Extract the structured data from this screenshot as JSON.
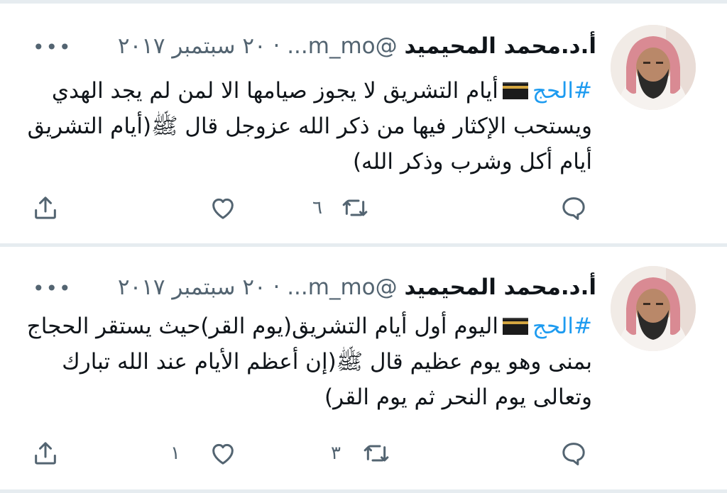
{
  "tweets": [
    {
      "author": "أ.د.محمد المحيميد",
      "handle": "@m_mo...",
      "dot": "·",
      "date": "٢٠ سبتمبر ٢٠١٧",
      "more": "•••",
      "hashtag": "#الحج",
      "text": "أيام التشريق لا يجوز صيامها الا لمن لم يجد الهدي ويستحب الإكثار فيها من ذكر الله عزوجل قال ﷺ(أيام التشريق أيام أكل وشرب وذكر الله)",
      "reply_count": "",
      "retweet_count": "٦",
      "like_count": ""
    },
    {
      "author": "أ.د.محمد المحيميد",
      "handle": "@m_mo...",
      "dot": "·",
      "date": "٢٠ سبتمبر ٢٠١٧",
      "more": "•••",
      "hashtag": "#الحج",
      "text": "اليوم أول أيام التشريق(يوم القر)حيث يستقر الحجاج بمنى وهو يوم عظيم قال ﷺ(إن أعظم الأيام عند الله تبارك وتعالى يوم النحر ثم يوم القر)",
      "reply_count": "",
      "retweet_count": "٣",
      "like_count": "١"
    }
  ],
  "icons": {
    "reply": "reply-icon",
    "retweet": "retweet-icon",
    "like": "heart-icon",
    "share": "share-icon",
    "more": "more-icon"
  },
  "colors": {
    "hashtag": "#1d9bf0",
    "muted": "#536471",
    "separator": "#e6ecf0"
  }
}
